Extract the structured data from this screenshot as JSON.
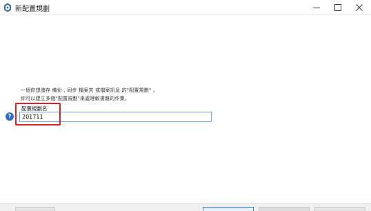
{
  "window": {
    "title": "新配置規劃",
    "minimize_icon": "minimize-icon",
    "maximize_icon": "maximize-icon",
    "close_icon": "close-icon"
  },
  "main": {
    "description_line1": "一個你想儲存 備份 , 同步 檔案夾 或檔案訊息 的\"配置規劃\" 。",
    "description_line2": "你可以建立多個\"配置規劃\"來處理較複雜的作業。",
    "name_label": "配置規劃名",
    "name_value": "201711",
    "help_icon": "question-icon"
  },
  "colors": {
    "highlight": "#e02020",
    "input_border": "#6fa3d8",
    "help_icon": "#2a6fc9"
  }
}
